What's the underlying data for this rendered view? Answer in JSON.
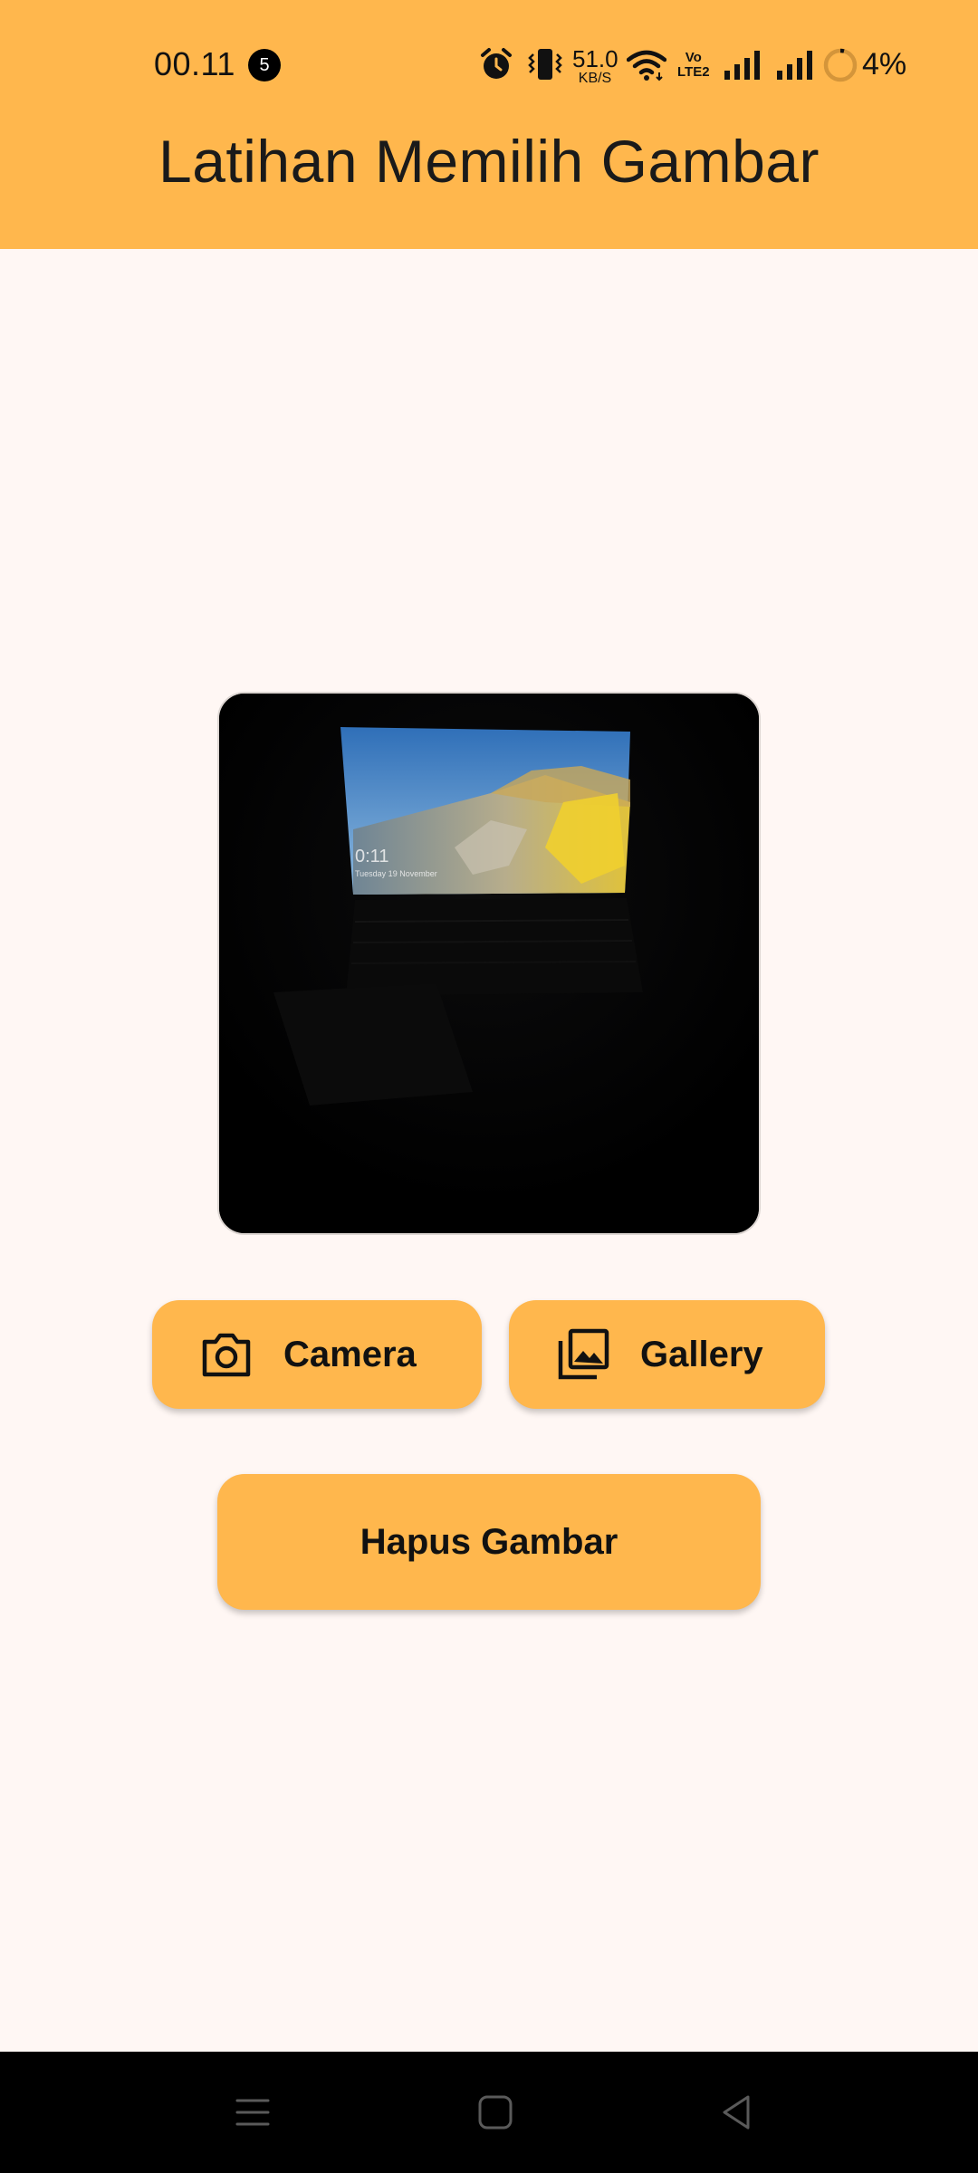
{
  "status_bar": {
    "time": "00.11",
    "notification_count": "5",
    "net_speed_value": "51.0",
    "net_speed_unit": "KB/S",
    "volte_line1": "Vo",
    "volte_line2": "LTE2",
    "battery_percent": "4%",
    "icons": [
      "alarm-icon",
      "vibrate-icon",
      "wifi-icon",
      "volte-icon",
      "signal-icon",
      "signal-icon",
      "battery-icon"
    ]
  },
  "app_bar": {
    "title": "Latihan Memilih Gambar",
    "color": "#FFB74D"
  },
  "preview_image": {
    "description_icon": "photo-preview",
    "overlay_time": "0:11",
    "overlay_date": "Tuesday 19 November"
  },
  "buttons": {
    "camera": {
      "label": "Camera",
      "icon": "camera-icon"
    },
    "gallery": {
      "label": "Gallery",
      "icon": "gallery-icon"
    },
    "delete": {
      "label": "Hapus Gambar"
    }
  },
  "nav_bar": {
    "items": [
      "menu-icon",
      "home-icon",
      "back-icon"
    ]
  },
  "colors": {
    "accent": "#FFB74D",
    "background": "#FFF7F4",
    "text": "#111111"
  }
}
